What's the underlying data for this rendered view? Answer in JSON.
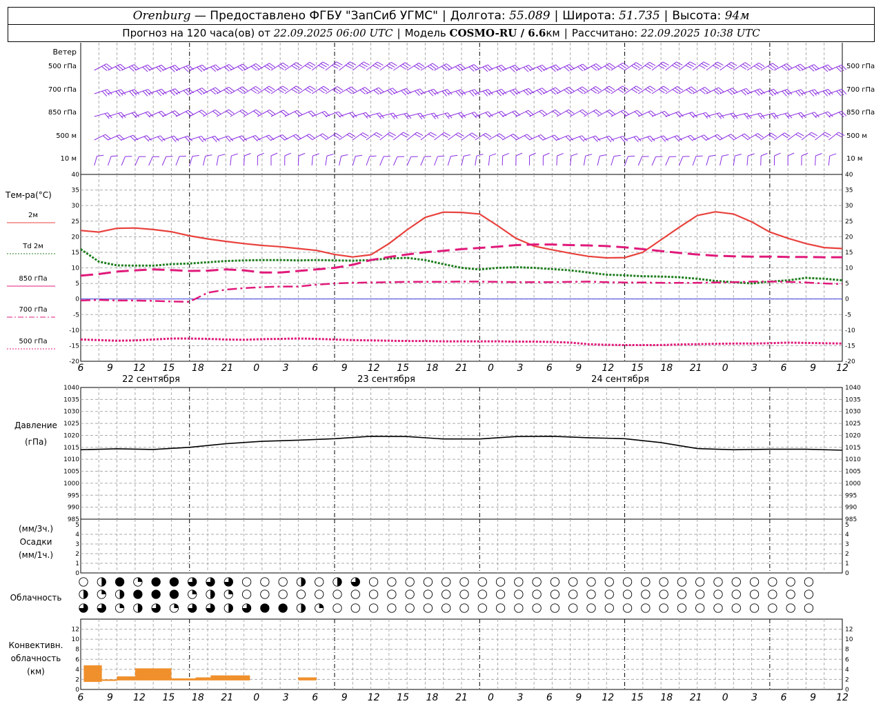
{
  "header": {
    "city": "Orenburg",
    "provider": "— Предоставлено ФГБУ \"ЗапСиб УГМС\"",
    "lon_label": "Долгота:",
    "lon": "55.089",
    "lat_label": "Широта:",
    "lat": "51.735",
    "alt_label": "Высота:",
    "alt": "94м",
    "forecast_label": "Прогноз на 120 часа(ов) от",
    "forecast_start": "22.09.2025 06:00 UTC",
    "model_label": "Модель",
    "model": "COSMO-RU / 6.6",
    "model_unit": "км",
    "computed_label": "Рассчитано:",
    "computed": "22.09.2025 10:38 UTC"
  },
  "colors": {
    "temp": "#e8413c",
    "dewpoint": "#1e7d1e",
    "t850": "#e0197a",
    "t700": "#e0197a",
    "t500": "#e0197a",
    "wind": "#8a2be2",
    "pressure": "#000000",
    "convective": "#f0902c",
    "zero_line": "#3c3cdc",
    "grid": "#aaaaaa"
  },
  "x_axis": {
    "hours_from_start_max": 126,
    "tick_labels": [
      "6",
      "9",
      "12",
      "15",
      "18",
      "21",
      "0",
      "3",
      "6",
      "9",
      "12",
      "15",
      "18",
      "21",
      "0",
      "3",
      "6",
      "9",
      "12",
      "15",
      "18",
      "21",
      "0",
      "3",
      "6",
      "9",
      "12"
    ],
    "day_labels": [
      "22 сентября",
      "23 сентября",
      "24 сентября"
    ]
  },
  "chart_data": [
    {
      "type": "barbs",
      "title": "Ветер",
      "levels": [
        "500 гПа",
        "700 гПа",
        "850 гПа",
        "500 м",
        "10  м"
      ],
      "direction_note": "Westerly to north-westerly flow at all levels; strongest aloft",
      "x_range_hours": [
        0,
        126
      ]
    },
    {
      "type": "line",
      "ylabel": "Тем-ра(°C)",
      "ylim": [
        -20,
        40
      ],
      "y_ticks": [
        40,
        35,
        30,
        25,
        20,
        15,
        10,
        5,
        0,
        -5,
        -10,
        -15,
        -20
      ],
      "legend": [
        "2м",
        "Td  2м",
        "850 гПа",
        "700 гПа",
        "500 гПа"
      ],
      "x_hours": [
        0,
        3,
        6,
        9,
        12,
        15,
        18,
        21,
        24,
        27,
        30,
        33,
        36,
        39,
        42,
        45,
        48,
        51,
        54,
        57,
        60,
        63,
        66,
        69,
        72,
        75,
        78,
        81,
        84,
        87,
        90,
        93,
        96,
        99,
        102,
        105,
        108,
        111,
        114,
        117,
        120,
        123,
        126
      ],
      "series": [
        {
          "name": "2м",
          "values": [
            22,
            21.5,
            22.7,
            22.8,
            22.3,
            21.6,
            20.3,
            19.3,
            18.5,
            17.8,
            17.2,
            16.8,
            16.2,
            15.6,
            14.3,
            13.5,
            14.2,
            17.8,
            22.2,
            26.2,
            27.9,
            27.8,
            27.3,
            23.5,
            19.5,
            17,
            15.8,
            14.7,
            13.7,
            13.2,
            13.3,
            15,
            19,
            23,
            26.8,
            28,
            27.3,
            24.8,
            21.5,
            19.5,
            17.8,
            16.5,
            16.2
          ]
        },
        {
          "name": "Td  2м",
          "values": [
            16,
            12,
            10.8,
            10.7,
            10.7,
            11.2,
            11.4,
            11.8,
            12.2,
            12.4,
            12.5,
            12.5,
            12.4,
            12.5,
            12.4,
            12.3,
            12.5,
            13,
            13.2,
            12.5,
            11.2,
            10,
            9.5,
            10,
            10.2,
            10,
            9.6,
            9.2,
            8.5,
            7.8,
            7.6,
            7.3,
            7.2,
            7,
            6.5,
            5.8,
            5.4,
            5,
            5.6,
            6,
            6.8,
            6.5,
            6
          ]
        },
        {
          "name": "850 гПа",
          "values": [
            7.5,
            8,
            8.8,
            9.2,
            9.5,
            9.3,
            9,
            9.1,
            9.5,
            9.2,
            8.5,
            8.5,
            9,
            9.5,
            10,
            11,
            12.5,
            13.5,
            14.3,
            15,
            15.5,
            16,
            16.4,
            16.8,
            17.3,
            17.5,
            17.5,
            17.3,
            17.2,
            17,
            16.6,
            16,
            15.4,
            14.8,
            14.3,
            13.9,
            13.7,
            13.6,
            13.6,
            13.5,
            13.5,
            13.4,
            13.4
          ]
        },
        {
          "name": "700 гПа",
          "values": [
            -0.5,
            -0.3,
            -0.5,
            -0.5,
            -0.6,
            -0.8,
            -0.9,
            2,
            3,
            3.5,
            3.8,
            4,
            4,
            4.6,
            5,
            5.2,
            5.3,
            5.4,
            5.5,
            5.5,
            5.5,
            5.6,
            5.6,
            5.5,
            5.4,
            5.4,
            5.4,
            5.5,
            5.6,
            5.4,
            5.3,
            5.3,
            5.2,
            5.2,
            5.2,
            5.3,
            5.4,
            5.6,
            5.6,
            5.5,
            5.3,
            5,
            4.8
          ]
        },
        {
          "name": "500 гПа",
          "values": [
            -13,
            -13.2,
            -13.4,
            -13.3,
            -13,
            -12.7,
            -12.7,
            -12.8,
            -13,
            -13.1,
            -12.9,
            -12.8,
            -12.7,
            -12.8,
            -13,
            -13.2,
            -13.3,
            -13.4,
            -13.5,
            -13.5,
            -13.6,
            -13.6,
            -13.6,
            -13.6,
            -13.7,
            -13.7,
            -13.8,
            -14,
            -14.5,
            -14.7,
            -14.8,
            -14.8,
            -14.8,
            -14.6,
            -14.5,
            -14.4,
            -14.3,
            -14.3,
            -14.2,
            -14,
            -14.1,
            -14.2,
            -14.3
          ]
        }
      ]
    },
    {
      "type": "line",
      "ylabel": "Давление",
      "ylabel_unit": "(гПа)",
      "ylim": [
        985,
        1040
      ],
      "y_ticks": [
        1040,
        1035,
        1030,
        1025,
        1020,
        1015,
        1010,
        1005,
        1000,
        995,
        990,
        985
      ],
      "x_hours": [
        0,
        6,
        12,
        18,
        24,
        30,
        36,
        42,
        48,
        54,
        60,
        66,
        72,
        78,
        84,
        90,
        96,
        102,
        108,
        114,
        120,
        126
      ],
      "series": [
        {
          "name": "Давление",
          "values": [
            1014,
            1014.4,
            1014.1,
            1015,
            1016.5,
            1017.5,
            1018,
            1018.6,
            1019.6,
            1019.5,
            1018.5,
            1018.5,
            1019.5,
            1019.6,
            1019,
            1018.6,
            1017,
            1014.5,
            1014,
            1014.2,
            1014.2,
            1013.8
          ]
        }
      ]
    },
    {
      "type": "bar",
      "ylabel": "Осадки",
      "ylabel_units": [
        "(мм/3ч.)",
        "(мм/1ч.)"
      ],
      "ylim": [
        0,
        5
      ],
      "y_ticks": [
        5,
        4,
        3,
        2,
        1,
        0
      ],
      "values": []
    },
    {
      "type": "table",
      "title": "Облачность",
      "rows": 3,
      "cols": 41,
      "x_range_hours": [
        0,
        120
      ],
      "cells": [
        [
          "e",
          "h",
          "f",
          "q",
          "f",
          "f",
          "t",
          "t",
          "t",
          "e",
          "e",
          "e",
          "h",
          "e",
          "h",
          "t",
          "e",
          "e",
          "e",
          "e",
          "e",
          "e",
          "e",
          "e",
          "e",
          "e",
          "e",
          "e",
          "e",
          "e",
          "e",
          "e",
          "e",
          "e",
          "e",
          "e",
          "e",
          "e",
          "e",
          "e",
          "e"
        ],
        [
          "h",
          "q",
          "h",
          "f",
          "f",
          "f",
          "q",
          "h",
          "q",
          "e",
          "e",
          "e",
          "e",
          "e",
          "e",
          "e",
          "e",
          "e",
          "e",
          "e",
          "e",
          "e",
          "e",
          "e",
          "e",
          "e",
          "e",
          "e",
          "e",
          "e",
          "e",
          "e",
          "e",
          "e",
          "e",
          "e",
          "e",
          "e",
          "e",
          "e",
          "e"
        ],
        [
          "t",
          "t",
          "q",
          "h",
          "t",
          "q",
          "t",
          "t",
          "h",
          "t",
          "f",
          "f",
          "h",
          "q",
          "e",
          "e",
          "e",
          "e",
          "e",
          "e",
          "e",
          "e",
          "e",
          "e",
          "e",
          "e",
          "e",
          "e",
          "e",
          "e",
          "e",
          "e",
          "e",
          "e",
          "e",
          "e",
          "e",
          "e",
          "e",
          "e",
          "e"
        ]
      ],
      "legend_note": "e=ясно, q=1/4, h=1/2, t=3/4, f=сплошная"
    },
    {
      "type": "bar",
      "ylabel": "Конвективн.",
      "ylabel_lines": [
        "облачность",
        "(км)"
      ],
      "ylim": [
        0,
        14
      ],
      "y_ticks": [
        12,
        10,
        8,
        6,
        4,
        2,
        0
      ],
      "bars_km": [
        {
          "x0": 0.5,
          "x1": 3.5,
          "bottom": 1.5,
          "top": 4.8
        },
        {
          "x0": 3.5,
          "x1": 6,
          "bottom": 1.7,
          "top": 2
        },
        {
          "x0": 6,
          "x1": 9,
          "bottom": 1.8,
          "top": 2.6
        },
        {
          "x0": 9,
          "x1": 15,
          "bottom": 1.8,
          "top": 4.2
        },
        {
          "x0": 15,
          "x1": 19,
          "bottom": 1.8,
          "top": 2.2
        },
        {
          "x0": 19,
          "x1": 21.5,
          "bottom": 1.8,
          "top": 2.4
        },
        {
          "x0": 21.5,
          "x1": 28,
          "bottom": 1.8,
          "top": 2.8
        },
        {
          "x0": 36,
          "x1": 39,
          "bottom": 1.8,
          "top": 2.4
        }
      ]
    }
  ]
}
